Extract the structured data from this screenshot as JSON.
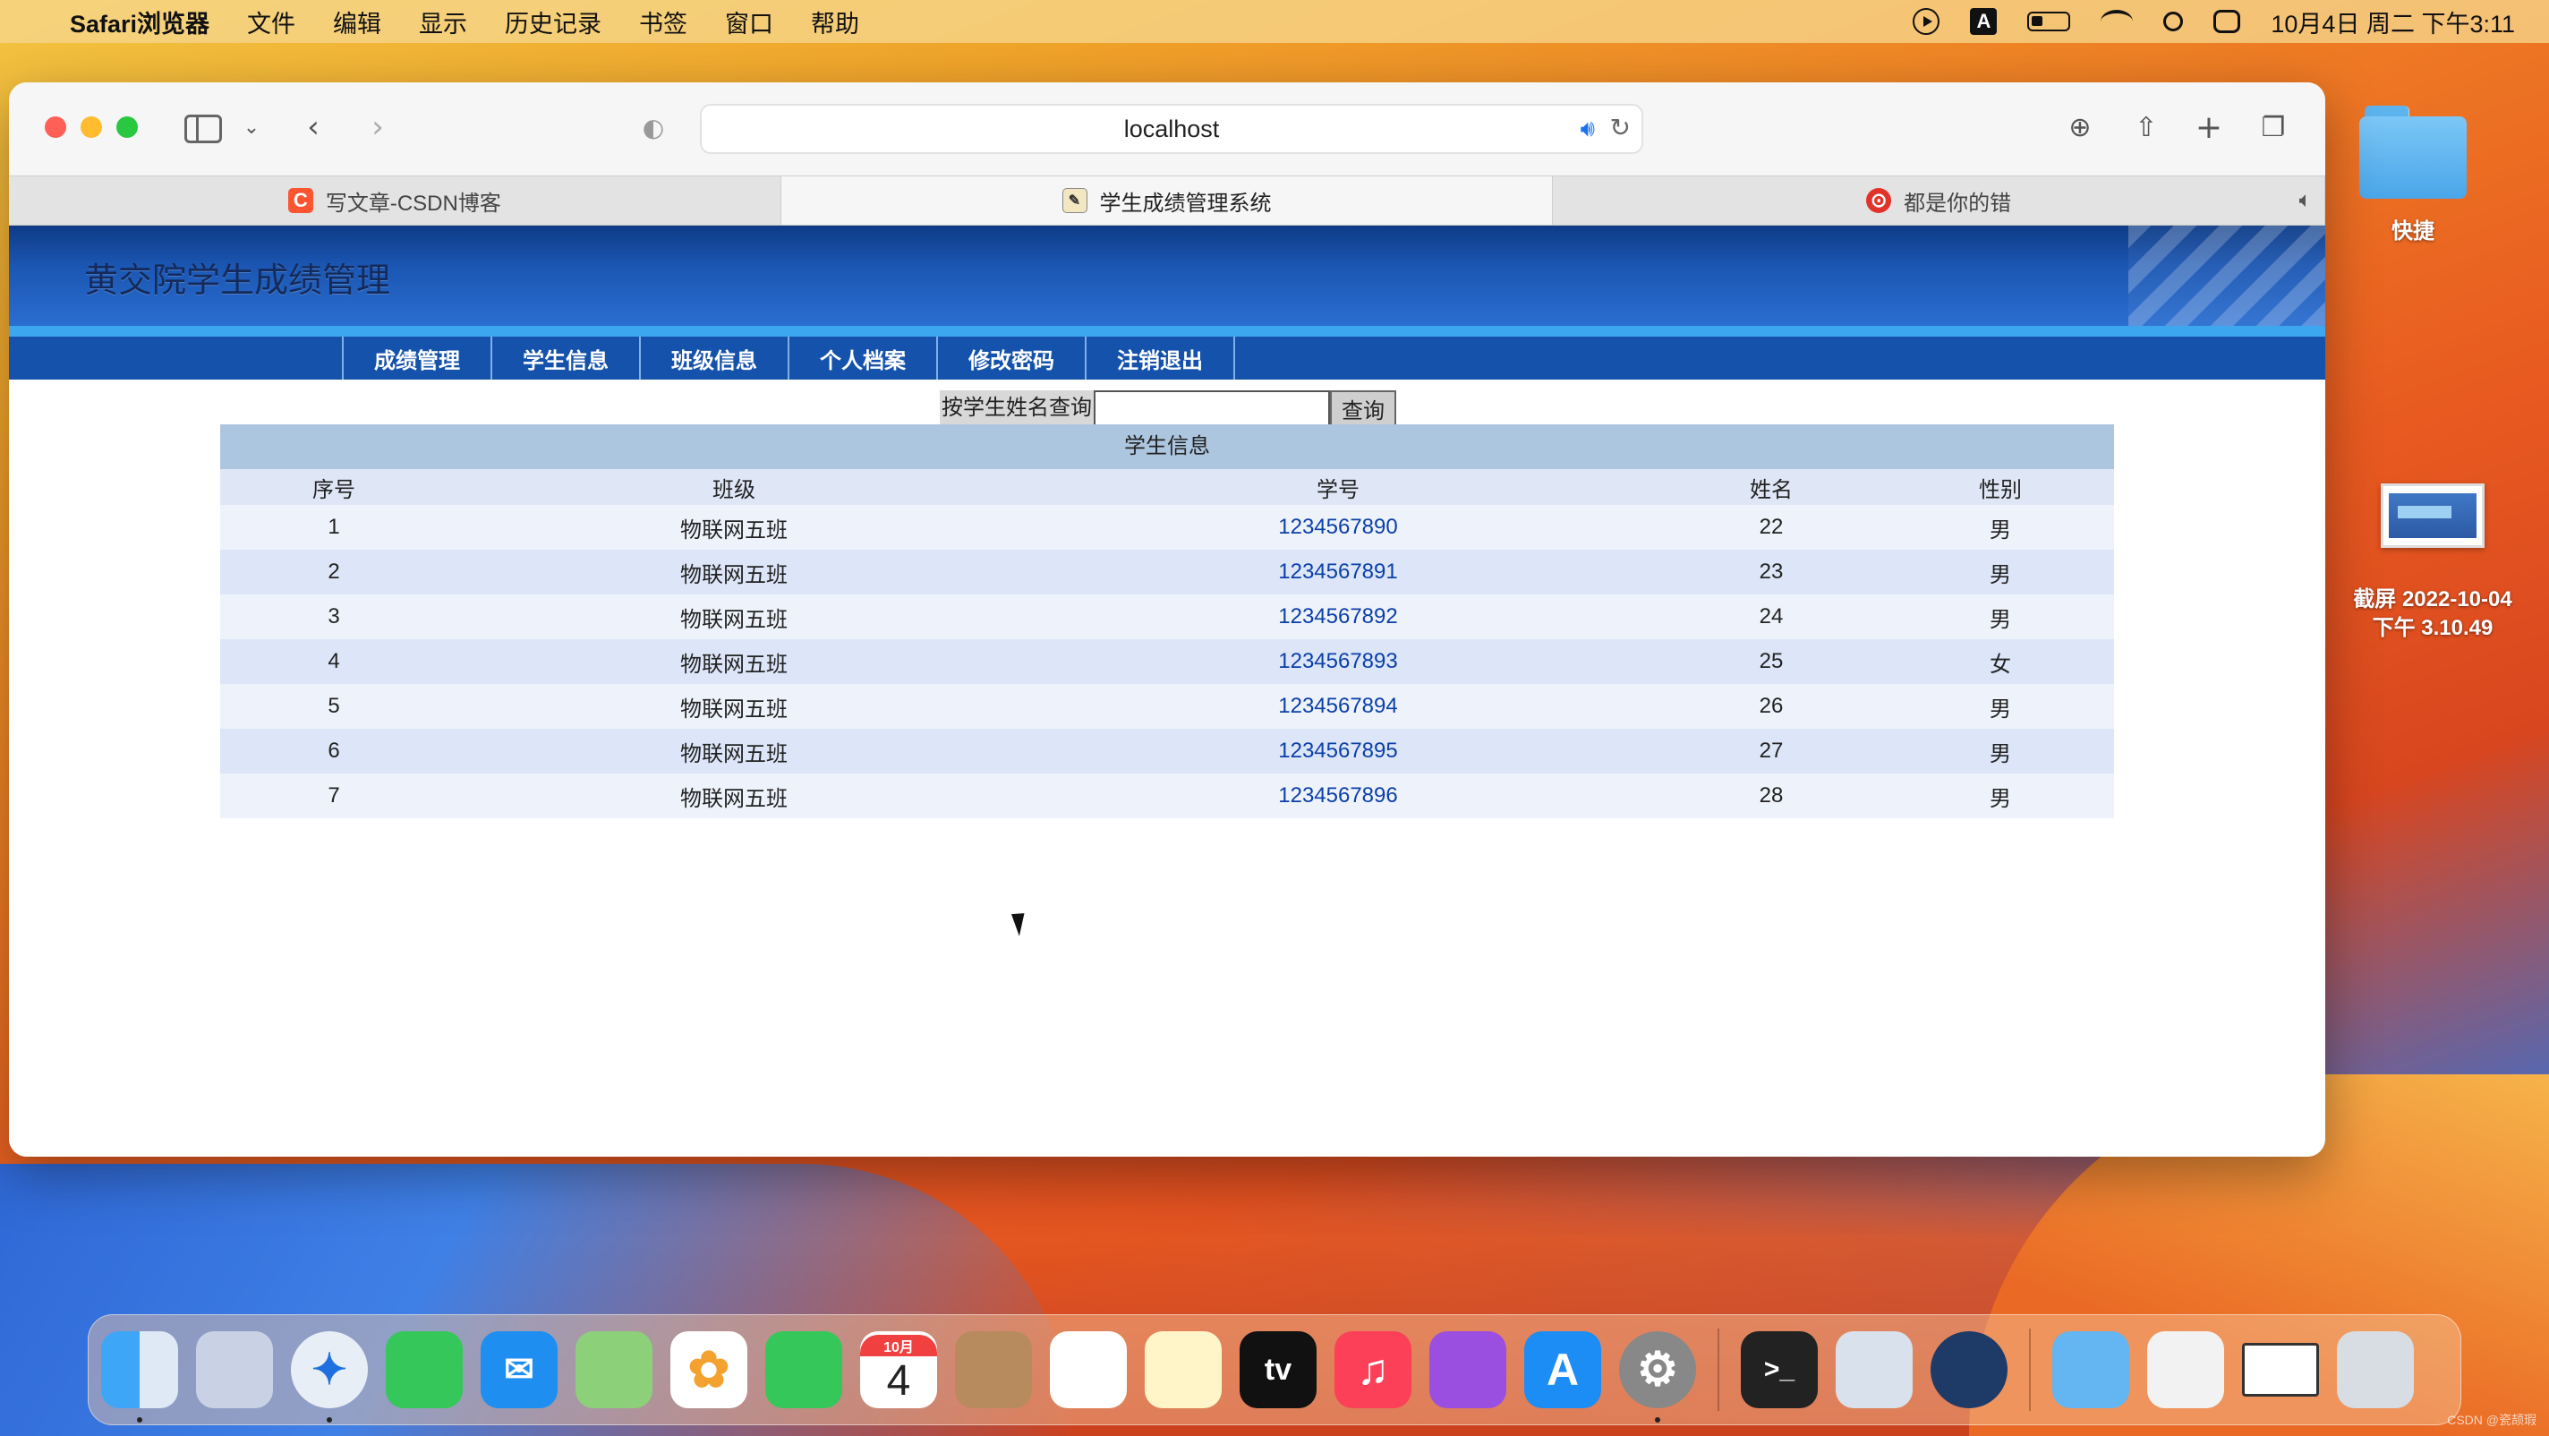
{
  "menubar": {
    "app_name": "Safari浏览器",
    "items": [
      "文件",
      "编辑",
      "显示",
      "历史记录",
      "书签",
      "窗口",
      "帮助"
    ],
    "input_method": "A",
    "clock": "10月4日 周二 下午3:11"
  },
  "desktop": {
    "folder_label": "快捷",
    "screenshot_label_line1": "截屏 2022-10-04",
    "screenshot_label_line2": "下午 3.10.49"
  },
  "browser": {
    "address": "localhost",
    "tabs": [
      {
        "label": "写文章-CSDN博客",
        "icon": "C"
      },
      {
        "label": "学生成绩管理系统",
        "icon": ""
      },
      {
        "label": "都是你的错",
        "icon": "⊙"
      }
    ]
  },
  "page": {
    "title": "黄交院学生成绩管理",
    "nav": [
      "成绩管理",
      "学生信息",
      "班级信息",
      "个人档案",
      "修改密码",
      "注销退出"
    ],
    "search_label": "按学生姓名查询",
    "search_value": "",
    "search_button": "查询",
    "table": {
      "caption": "学生信息",
      "headers": [
        "序号",
        "班级",
        "学号",
        "姓名",
        "性别"
      ],
      "rows": [
        [
          "1",
          "物联网五班",
          "1234567890",
          "22",
          "男"
        ],
        [
          "2",
          "物联网五班",
          "1234567891",
          "23",
          "男"
        ],
        [
          "3",
          "物联网五班",
          "1234567892",
          "24",
          "男"
        ],
        [
          "4",
          "物联网五班",
          "1234567893",
          "25",
          "女"
        ],
        [
          "5",
          "物联网五班",
          "1234567894",
          "26",
          "男"
        ],
        [
          "6",
          "物联网五班",
          "1234567895",
          "27",
          "男"
        ],
        [
          "7",
          "物联网五班",
          "1234567896",
          "28",
          "男"
        ]
      ]
    }
  },
  "dock": {
    "calendar_month": "10月",
    "calendar_day": "4",
    "tv_label": "tv",
    "terminal_label": ">_"
  },
  "watermark": "CSDN @瓷颉瑕"
}
